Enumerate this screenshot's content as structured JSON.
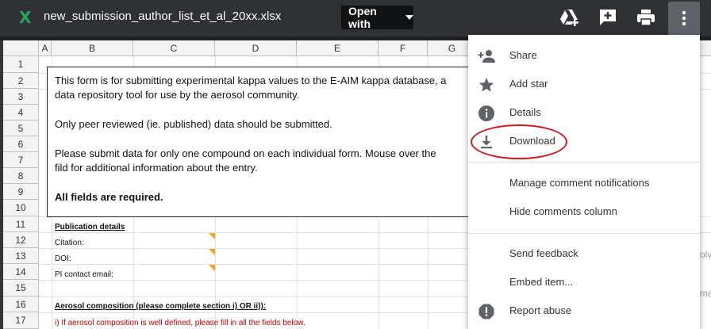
{
  "header": {
    "file_icon": "excel-x-icon",
    "file_icon_glyph": "X",
    "filename": "new_submission_author_list_et_al_20xx.xlsx",
    "open_with_label": "Open with",
    "icons": [
      "add-to-drive-icon",
      "add-comment-icon",
      "print-icon",
      "more-vert-icon"
    ]
  },
  "sheet": {
    "columns": [
      "A",
      "B",
      "C",
      "D",
      "E",
      "F",
      "G"
    ],
    "rows": [
      "1",
      "2",
      "3",
      "4",
      "5",
      "6",
      "7",
      "8",
      "9",
      "10",
      "11",
      "12",
      "13",
      "14",
      "15",
      "16",
      "17"
    ],
    "info_box": {
      "line1": "This form is for submitting experimental kappa values to the E-AIM kappa database, a",
      "line2": "data repository tool for use by the aerosol community.",
      "line3": "Only peer reviewed (ie. published) data should be submitted.",
      "line4": "Please submit data for only one compound on each individual form. Mouse over the",
      "line5": "fild for additional information about the entry.",
      "line6": "All fields are required."
    },
    "cells": {
      "publication_details": "Publication details",
      "citation": "Citation:",
      "doi": "DOI:",
      "pi_contact": "PI contact email:",
      "aerosol_composition": "Aerosol composition (please complete section i) OR ii)):",
      "section_i": "i) If aerosol composition is well defined, please fill in all the fields below."
    },
    "right_clipped": [
      "olv",
      "ma"
    ]
  },
  "menu": {
    "items": [
      {
        "label": "Share",
        "icon": "person-add-icon"
      },
      {
        "label": "Add star",
        "icon": "star-icon"
      },
      {
        "label": "Details",
        "icon": "info-icon"
      },
      {
        "label": "Download",
        "icon": "download-icon"
      },
      {
        "label": "Manage comment notifications",
        "icon": ""
      },
      {
        "label": "Hide comments column",
        "icon": ""
      },
      {
        "label": "Send feedback",
        "icon": ""
      },
      {
        "label": "Embed item...",
        "icon": ""
      },
      {
        "label": "Report abuse",
        "icon": "report-icon"
      }
    ]
  },
  "colors": {
    "topbar": "#303134",
    "excel_green": "#21a464",
    "annotation_red": "#d0191f",
    "comment_marker": "#f4a21d"
  }
}
